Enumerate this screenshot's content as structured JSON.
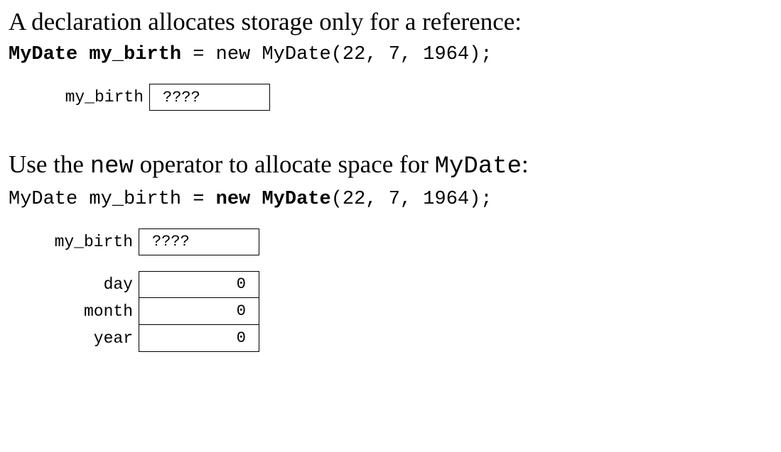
{
  "section1": {
    "heading_text": "A declaration allocates storage only for a reference:",
    "code_bold": "MyDate my_birth",
    "code_rest": " = new MyDate(22, 7, 1964);",
    "diagram": {
      "var_label": "my_birth",
      "var_value": "????"
    }
  },
  "section2": {
    "heading_pre": "Use the ",
    "heading_tt1": "new",
    "heading_mid": " operator to allocate space for ",
    "heading_tt2": "MyDate",
    "heading_end": ":",
    "code_pre": "MyDate my_birth = ",
    "code_bold": "new MyDate",
    "code_post": "(22, 7, 1964);",
    "diagram": {
      "var_label": "my_birth",
      "var_value": "????",
      "fields": [
        {
          "label": "day",
          "value": "0"
        },
        {
          "label": "month",
          "value": "0"
        },
        {
          "label": "year",
          "value": "0"
        }
      ]
    }
  }
}
